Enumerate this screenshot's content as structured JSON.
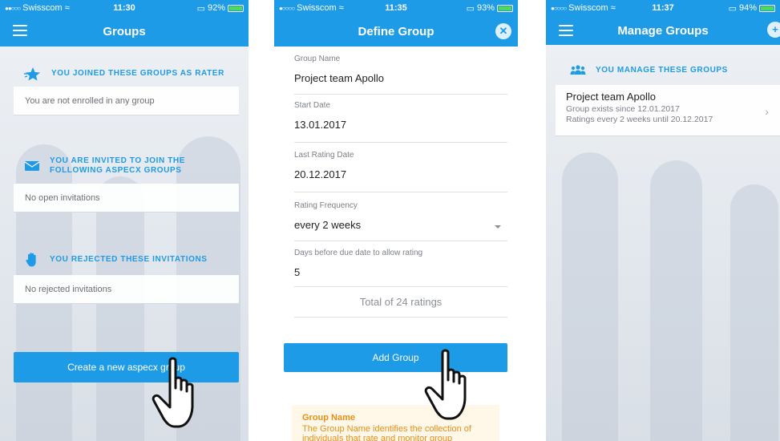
{
  "status": [
    {
      "carrier": "Swisscom",
      "time": "11:30",
      "battery": "92%",
      "battery_level": 0.92
    },
    {
      "carrier": "Swisscom",
      "time": "11:35",
      "battery": "93%",
      "battery_level": 0.93
    },
    {
      "carrier": "Swisscom",
      "time": "11:37",
      "battery": "94%",
      "battery_level": 0.94
    }
  ],
  "groups_screen": {
    "title": "Groups",
    "sections": [
      {
        "heading": "YOU JOINED THESE GROUPS AS RATER",
        "empty_text": "You are not enrolled in any group",
        "icon": "star-icon"
      },
      {
        "heading_line1": "YOU ARE INVITED TO JOIN THE",
        "heading_line2": "FOLLOWING ASPECX GROUPS",
        "empty_text": "No open invitations",
        "icon": "envelope-icon"
      },
      {
        "heading": "YOU REJECTED THESE INVITATIONS",
        "empty_text": "No rejected invitations",
        "icon": "hand-stop-icon"
      }
    ],
    "create_button": "Create a new aspecx group"
  },
  "define_screen": {
    "title": "Define Group",
    "fields": [
      {
        "label": "Group Name",
        "value": "Project team Apollo"
      },
      {
        "label": "Start Date",
        "value": "13.01.2017"
      },
      {
        "label": "Last Rating Date",
        "value": "20.12.2017"
      },
      {
        "label": "Rating Frequency",
        "value": "every 2 weeks"
      },
      {
        "label": "Days before due date to allow rating",
        "value": "5"
      }
    ],
    "total": "Total of 24 ratings",
    "add_button": "Add Group",
    "help_title": "Group Name",
    "help_text": "The Group Name identifies the collection of individuals that rate and monitor group"
  },
  "manage_screen": {
    "title": "Manage Groups",
    "heading": "YOU MANAGE THESE GROUPS",
    "group": {
      "name": "Project team Apollo",
      "since": "Group exists since 12.01.2017",
      "ratings": "Ratings every 2 weeks until 20.12.2017"
    }
  },
  "colors": {
    "accent": "#1e9be6",
    "help_text": "#e6901a"
  }
}
